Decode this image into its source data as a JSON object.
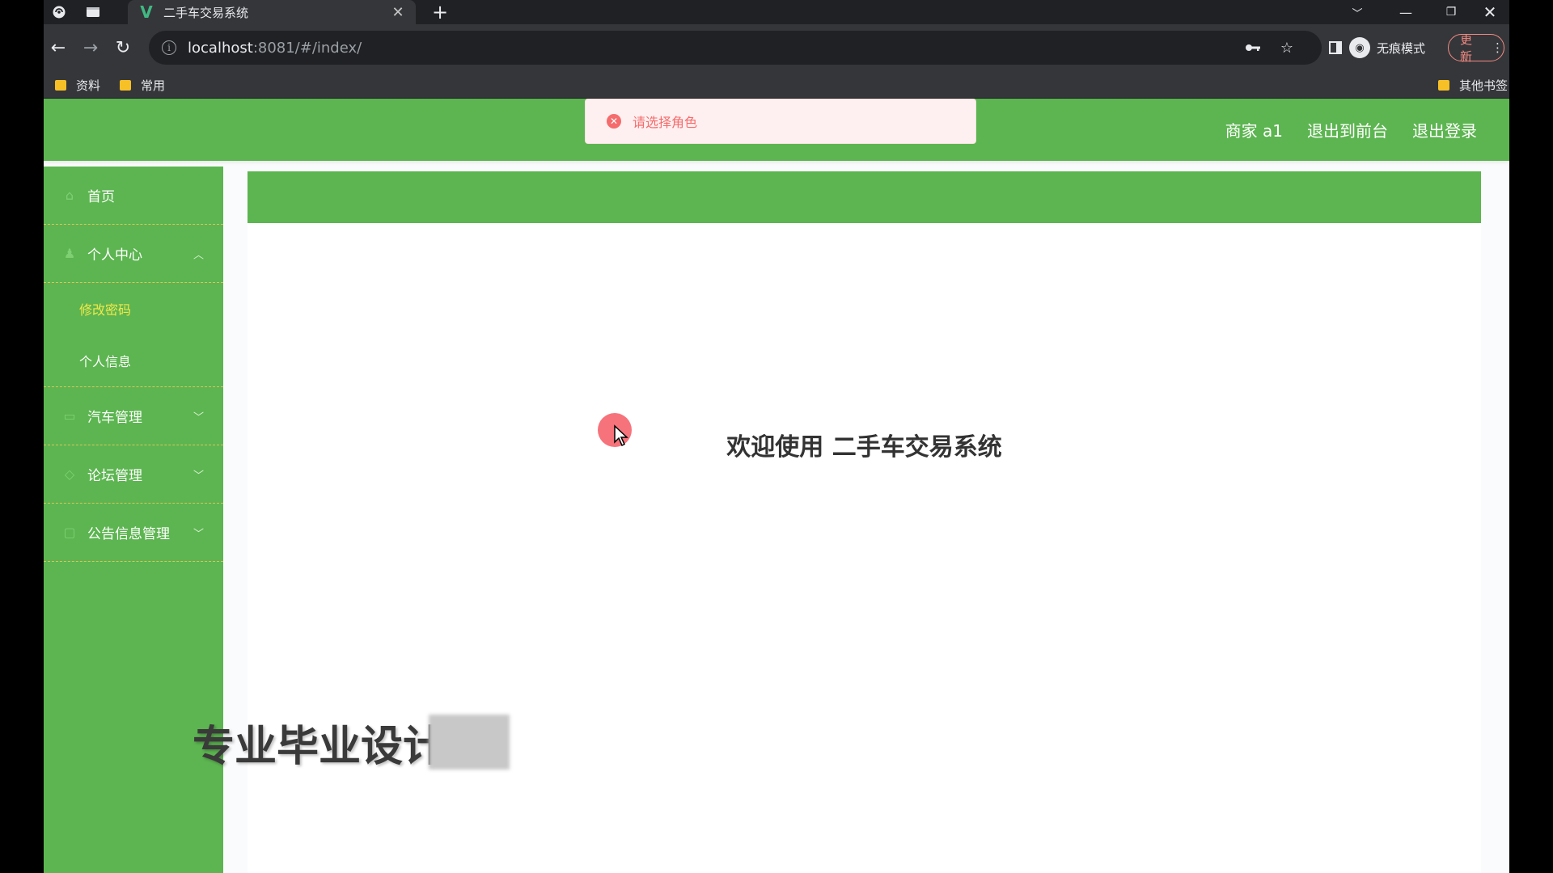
{
  "browser": {
    "tab_title": "二手车交易系统",
    "tab_close": "✕",
    "new_tab": "+",
    "url_host": "localhost",
    "url_rest": ":8081/#/index/",
    "incognito_label": "无痕模式",
    "update_label": "更新",
    "bookmarks": [
      "资料",
      "常用"
    ],
    "other_bookmarks": "其他书签"
  },
  "header": {
    "user": "商家 a1",
    "to_front": "退出到前台",
    "logout": "退出登录"
  },
  "toast": {
    "message": "请选择角色",
    "type": "error"
  },
  "sidebar": {
    "home": "首页",
    "personal_center": "个人中心",
    "change_password": "修改密码",
    "personal_info": "个人信息",
    "car_management": "汽车管理",
    "forum_management": "论坛管理",
    "notice_management": "公告信息管理"
  },
  "main": {
    "welcome": "欢迎使用 二手车交易系统"
  },
  "watermark": {
    "text": "专业毕业设计"
  },
  "colors": {
    "theme_green": "#5cb550",
    "active_submenu": "#f2e84a",
    "error_red": "#f56c6c"
  }
}
